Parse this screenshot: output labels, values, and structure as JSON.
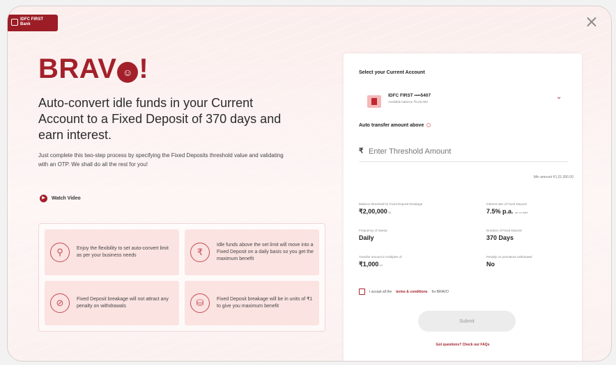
{
  "logo": {
    "text": "IDFC FIRST Bank"
  },
  "close_icon": "×",
  "hero": {
    "brand_pre": "BRAV",
    "brand_post": "!",
    "headline": "Auto-convert idle funds in your Current Account to a Fixed Deposit of 370 days and earn interest.",
    "subtext": "Just complete this two-step process by specifying the Fixed Deposits threshold value and validating with an OTP. We shall do all the rest for you!",
    "watch_video": "Watch Video"
  },
  "benefits": [
    {
      "icon": "flexibility-icon",
      "text": "Enjoy the flexibility to set auto-convert limit as per your business needs"
    },
    {
      "icon": "money-bag-icon",
      "text": "Idle funds above the set limit will move into a Fixed Deposit on a daily basis so you get the maximum benefit"
    },
    {
      "icon": "no-penalty-icon",
      "text": "Fixed Deposit breakage will not attract any penalty on withdrawals"
    },
    {
      "icon": "coins-icon",
      "text": "Fixed Deposit breakage will be in units of ₹1 to give you maximum benefit"
    }
  ],
  "form": {
    "select_account_label": "Select your Current Account",
    "account_name": "IDFC FIRST  ••••5407",
    "account_sub": "Available balance ₹5,00,000",
    "auto_transfer_label": "Auto transfer amount above",
    "rupee": "₹",
    "amount_placeholder": "Enter Threshold Amount",
    "min_amount": "Min amount ₹1,01,000.00",
    "stats": [
      {
        "label": "Balance threshold for Fixed Deposit breakage",
        "value": "₹2,00,000",
        "suffix": ".00"
      },
      {
        "label": "Interest rate of Fixed Deposit",
        "value": "7.5% p.a.",
        "suffix": "as on date"
      },
      {
        "label": "Frequency of sweep",
        "value": "Daily",
        "suffix": ""
      },
      {
        "label": "Duration of Fixed Deposit",
        "value": "370 Days",
        "suffix": ""
      },
      {
        "label": "Transfer amount in multiples of",
        "value": "₹1,000",
        "suffix": ".00"
      },
      {
        "label": "Penalty on premature withdrawal",
        "value": "No",
        "suffix": ""
      }
    ],
    "terms_pre": "I accept all the",
    "terms_link": "terms & conditions",
    "terms_post": "for BRAVO",
    "submit": "Submit",
    "faq": "Got questions? Check our FAQs"
  }
}
